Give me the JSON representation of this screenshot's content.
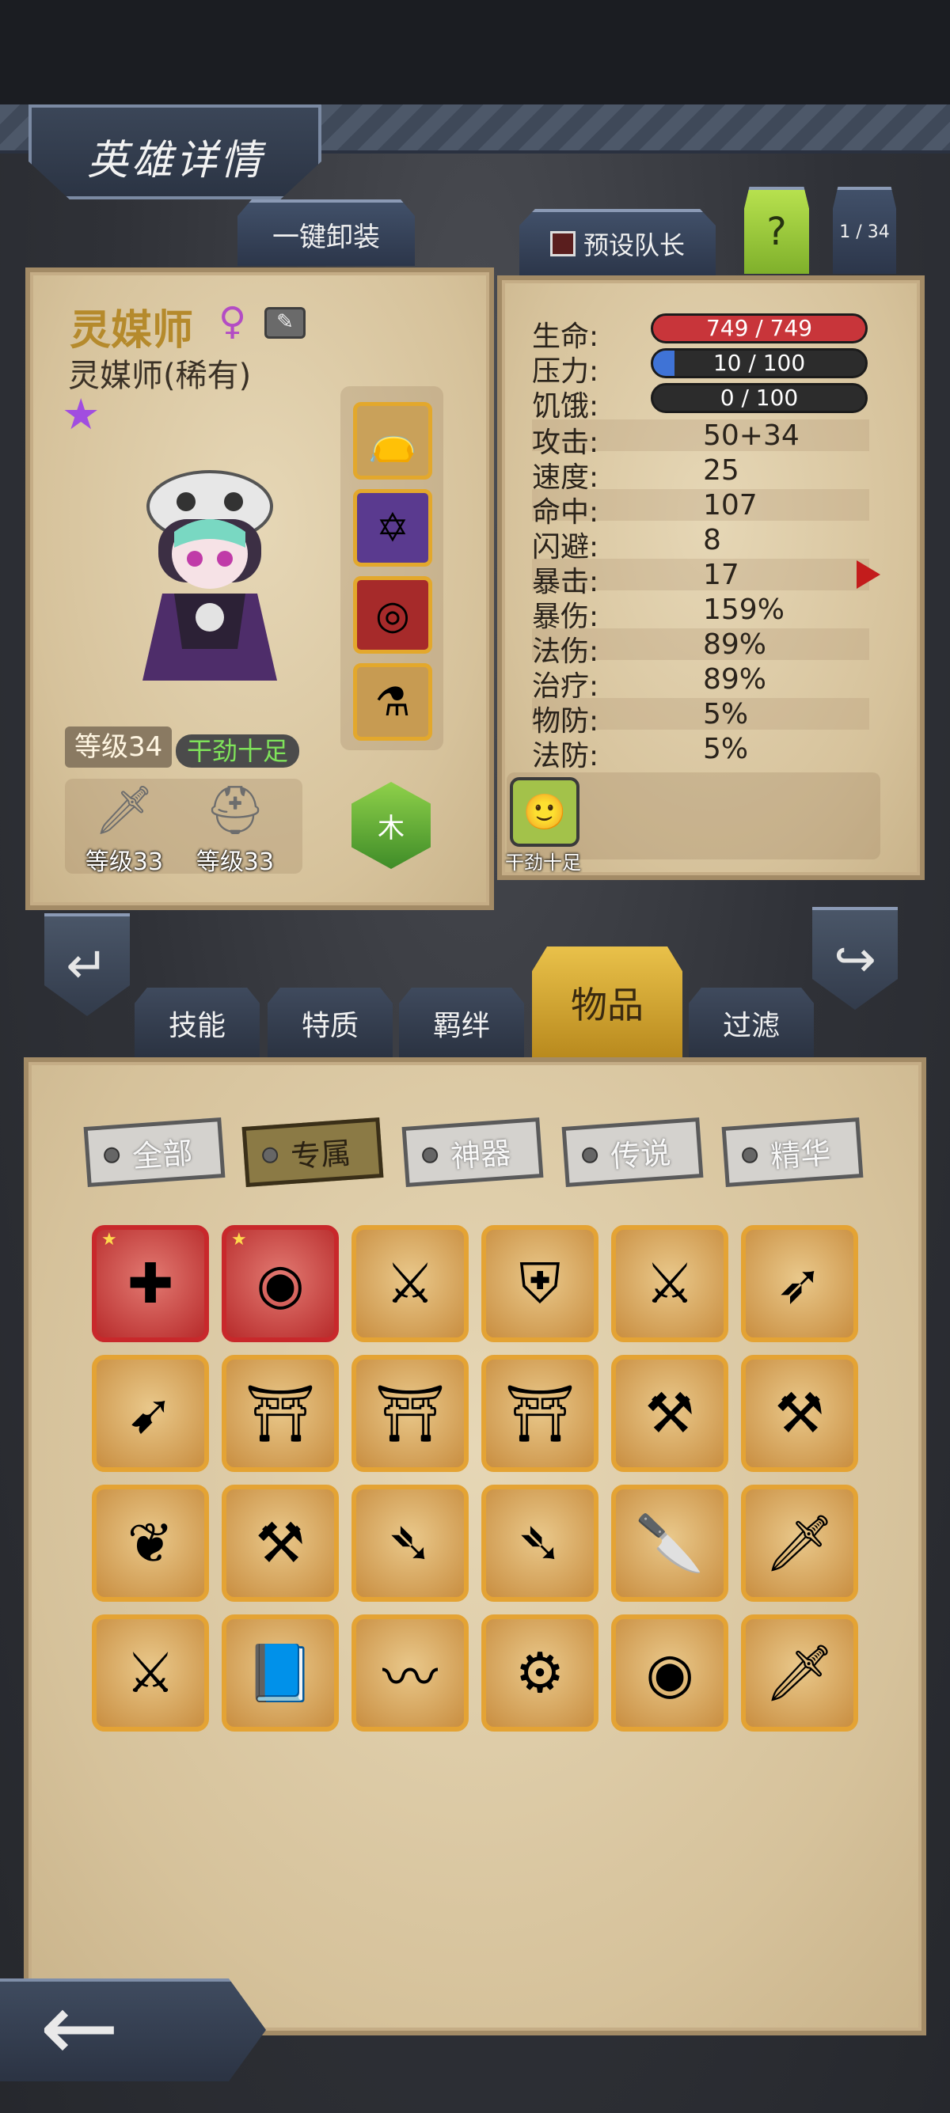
{
  "header": {
    "title": "英雄详情",
    "unequip_all": "一键卸装",
    "preset_leader": "预设队长",
    "help": "?",
    "page_counter": "1 / 34"
  },
  "hero": {
    "name": "灵媒师",
    "gender_symbol": "♀",
    "class_rarity": "灵媒师(稀有)",
    "level": "等级34",
    "status": "干劲十足",
    "element": "木",
    "weapon_level": "等级33",
    "armor_level": "等级33",
    "equipment_icons": [
      "bag-icon",
      "rune-icon",
      "ring-icon",
      "potion-icon"
    ]
  },
  "stats": {
    "life_label": "生命:",
    "life_value": "749 / 749",
    "life_fraction": 1.0,
    "stress_label": "压力:",
    "stress_value": "10 / 100",
    "stress_fraction": 0.1,
    "hunger_label": "饥饿:",
    "hunger_value": "0 / 100",
    "hunger_fraction": 0.0,
    "rows": [
      {
        "label": "攻击:",
        "value": "50+34"
      },
      {
        "label": "速度:",
        "value": "25"
      },
      {
        "label": "命中:",
        "value": "107"
      },
      {
        "label": "闪避:",
        "value": "8"
      },
      {
        "label": "暴击:",
        "value": "17"
      },
      {
        "label": "暴伤:",
        "value": "159%"
      },
      {
        "label": "法伤:",
        "value": "89%"
      },
      {
        "label": "治疗:",
        "value": "89%"
      },
      {
        "label": "物防:",
        "value": "5%"
      },
      {
        "label": "法防:",
        "value": "5%"
      }
    ],
    "trait_label": "干劲十足"
  },
  "colors": {
    "life": "#c8353a",
    "stress": "#3f73d6",
    "hunger": "#555555"
  },
  "tabs": [
    "技能",
    "特质",
    "羁绊",
    "物品",
    "过滤"
  ],
  "filters": [
    "全部",
    "专属",
    "神器",
    "传说",
    "精华"
  ],
  "items": [
    [
      "medkit-icon",
      "orb-icon",
      "claw-icon",
      "shield-icon",
      "daggers-icon",
      "bow-icon"
    ],
    [
      "crossbow-icon",
      "robe-icon",
      "robe-icon",
      "robe-icon",
      "axe-icon",
      "axe-icon"
    ],
    [
      "fan-icon",
      "halberd-icon",
      "spear-icon",
      "spear-icon",
      "blade-icon",
      "sword-icon"
    ],
    [
      "katana-icon",
      "tome-icon",
      "kris-icon",
      "drill-icon",
      "orb-icon",
      "sword-icon"
    ]
  ]
}
